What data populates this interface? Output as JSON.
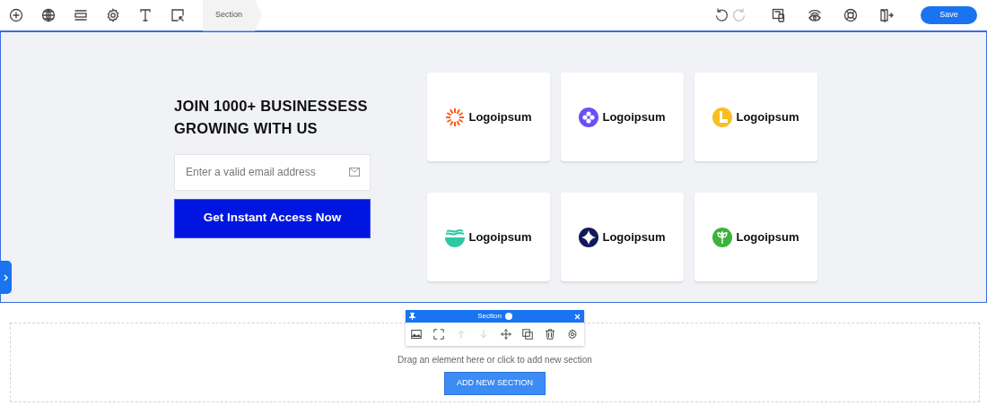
{
  "topbar": {
    "breadcrumb": "Section",
    "history": [
      {
        "kind": "undo",
        "disabled": false
      },
      {
        "kind": "redo",
        "disabled": true
      }
    ],
    "save": "Save"
  },
  "hero": {
    "heading": "JOIN 1000+ BUSINESSESS GROWING WITH US",
    "email": {
      "placeholder": "Enter a valid email address"
    },
    "cta": "Get Instant Access Now",
    "logos": [
      {
        "kind": "sun",
        "color": "#ff5a1f",
        "label": "Logoipsum"
      },
      {
        "kind": "clover",
        "color": "#6c4ef5",
        "label": "Logoipsum"
      },
      {
        "kind": "letter",
        "color": "#fbbd23",
        "label": "Logoipsum"
      },
      {
        "kind": "waves",
        "color": "#2cc9a5",
        "label": "Logoipsum"
      },
      {
        "kind": "star",
        "color": "#12195a",
        "label": "Logoipsum"
      },
      {
        "kind": "leaf",
        "color": "#3db33b",
        "label": "Logoipsum"
      }
    ]
  },
  "section_toolbar": {
    "title": "Section",
    "tools": [
      {
        "kind": "image",
        "disabled": false
      },
      {
        "kind": "resize",
        "disabled": false
      },
      {
        "kind": "up",
        "disabled": true
      },
      {
        "kind": "down",
        "disabled": true
      },
      {
        "kind": "move",
        "disabled": false
      },
      {
        "kind": "duplicate",
        "disabled": false
      },
      {
        "kind": "delete",
        "disabled": false
      },
      {
        "kind": "settings",
        "disabled": false
      }
    ]
  },
  "dropzone": {
    "hint": "Drag an element here or click to add new section",
    "button": "ADD NEW SECTION"
  }
}
